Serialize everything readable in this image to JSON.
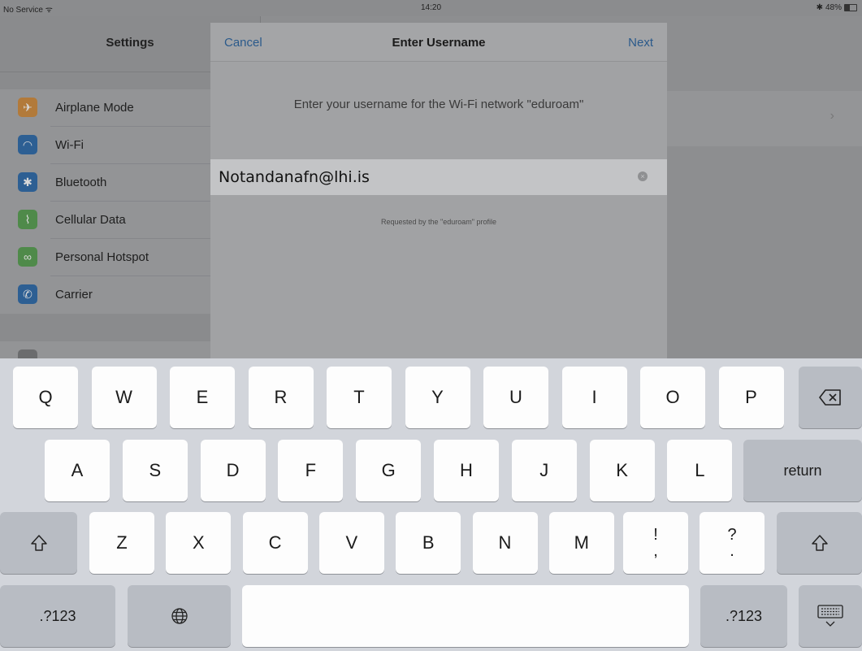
{
  "status_bar": {
    "carrier": "No Service",
    "time": "14:20",
    "battery": "48%"
  },
  "sidebar": {
    "title": "Settings",
    "items": [
      {
        "label": "Airplane Mode",
        "icon": "airplane-icon",
        "color": "#b27a3a",
        "glyph": "✈"
      },
      {
        "label": "Wi-Fi",
        "icon": "wifi-icon",
        "color": "#2d5f93",
        "glyph": "◠"
      },
      {
        "label": "Bluetooth",
        "icon": "bluetooth-icon",
        "color": "#2d5f93",
        "glyph": "✱"
      },
      {
        "label": "Cellular Data",
        "icon": "antenna-icon",
        "color": "#4f8a4a",
        "glyph": "⌇"
      },
      {
        "label": "Personal Hotspot",
        "icon": "hotspot-icon",
        "color": "#4f8a4a",
        "glyph": "∞"
      },
      {
        "label": "Carrier",
        "icon": "phone-icon",
        "color": "#2d5f93",
        "glyph": "✆"
      }
    ]
  },
  "dialog": {
    "cancel_label": "Cancel",
    "title": "Enter Username",
    "next_label": "Next",
    "prompt": "Enter your username for the Wi-Fi network \"eduroam\"",
    "username_value": "Notandanafn@lhi.is",
    "requested_text": "Requested by the \"eduroam\" profile"
  },
  "keyboard": {
    "row1": [
      "Q",
      "W",
      "E",
      "R",
      "T",
      "Y",
      "U",
      "I",
      "O",
      "P"
    ],
    "row2": [
      "A",
      "S",
      "D",
      "F",
      "G",
      "H",
      "J",
      "K",
      "L"
    ],
    "row3": [
      "Z",
      "X",
      "C",
      "V",
      "B",
      "N",
      "M"
    ],
    "return_label": "return",
    "numbers_label": ".?123",
    "punct1": {
      "top": "!",
      "bottom": ","
    },
    "punct2": {
      "top": "?",
      "bottom": "."
    }
  }
}
